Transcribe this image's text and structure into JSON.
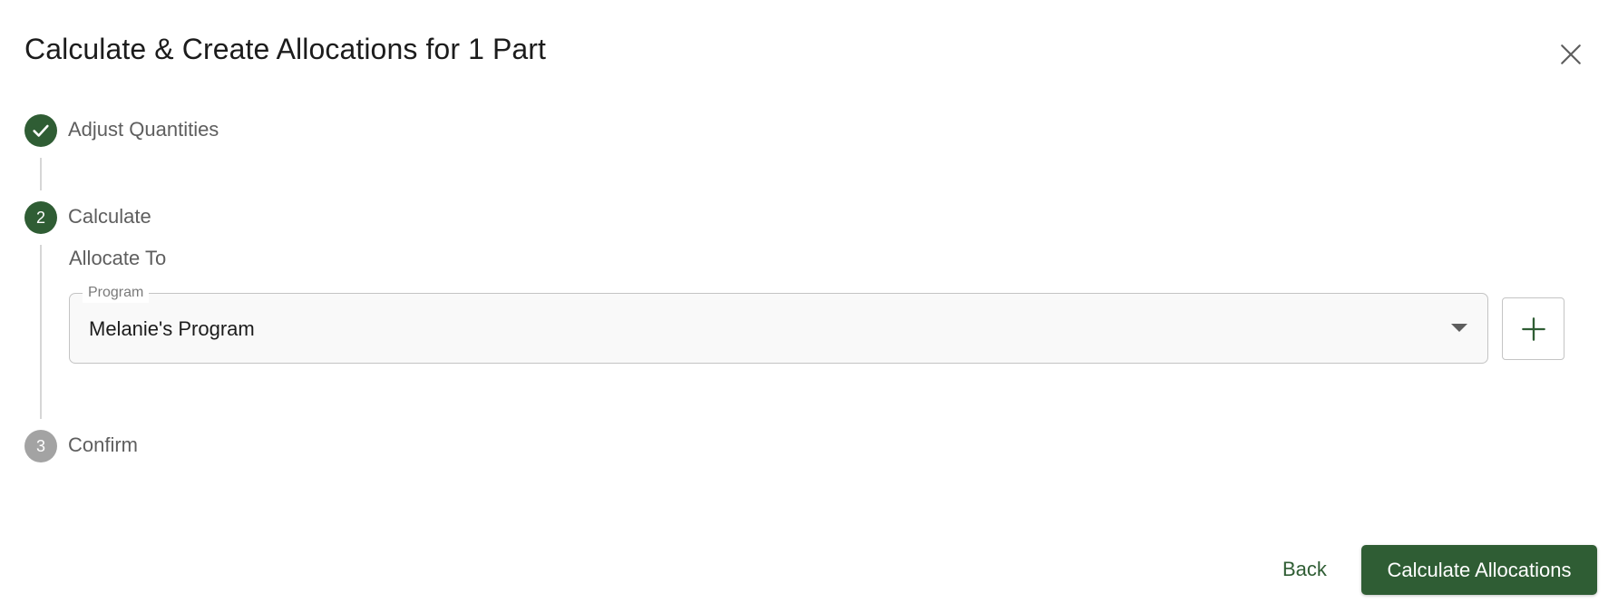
{
  "dialog": {
    "title": "Calculate & Create Allocations for 1 Part",
    "close_icon": "close-icon"
  },
  "steps": [
    {
      "label": "Adjust Quantities",
      "status": "completed",
      "marker": "check-icon"
    },
    {
      "label": "Calculate",
      "status": "active",
      "marker": "2"
    },
    {
      "label": "Confirm",
      "status": "pending",
      "marker": "3"
    }
  ],
  "calculate_step": {
    "section_label": "Allocate To",
    "program_field": {
      "label": "Program",
      "value": "Melanie's Program"
    },
    "add_icon": "plus-icon"
  },
  "actions": {
    "back_label": "Back",
    "primary_label": "Calculate Allocations"
  },
  "colors": {
    "accent": "#2f5d34",
    "pending": "#a3a3a3",
    "text_muted": "#5e5e5e"
  }
}
